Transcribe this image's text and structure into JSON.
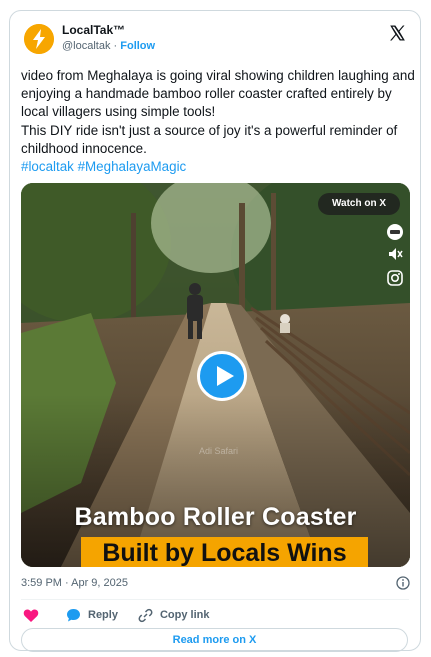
{
  "author": {
    "display_name": "LocalTak™",
    "handle": "@localtak",
    "separator": " · ",
    "follow_label": "Follow"
  },
  "tweet": {
    "line1": "video from Meghalaya is going viral showing children laughing and enjoying a handmade bamboo roller coaster crafted entirely by local villagers using simple tools!",
    "line2": "This DIY ride isn't just a source of joy it's a powerful reminder of childhood innocence.",
    "hashtags": "#localtak #MeghalayaMagic"
  },
  "media": {
    "watch_label": "Watch on X",
    "watermark": "Adi Safari",
    "caption_top": "Bamboo Roller Coaster",
    "caption_bottom": "Built by Locals Wins",
    "caption_highlight_color": "#f5a400"
  },
  "meta": {
    "timestamp": "3:59 PM · Apr 9, 2025"
  },
  "actions": {
    "reply_label": "Reply",
    "copy_link_label": "Copy link"
  },
  "read_more_label": "Read more on X",
  "colors": {
    "accent": "#1d9bf0",
    "like": "#f91880",
    "text": "#0f1419",
    "muted": "#536471"
  },
  "icons": [
    "localtak-logo-icon",
    "x-logo-icon",
    "captions-icon",
    "audio-icon",
    "instagram-icon",
    "play-icon",
    "info-icon",
    "heart-icon",
    "reply-icon",
    "link-icon"
  ]
}
